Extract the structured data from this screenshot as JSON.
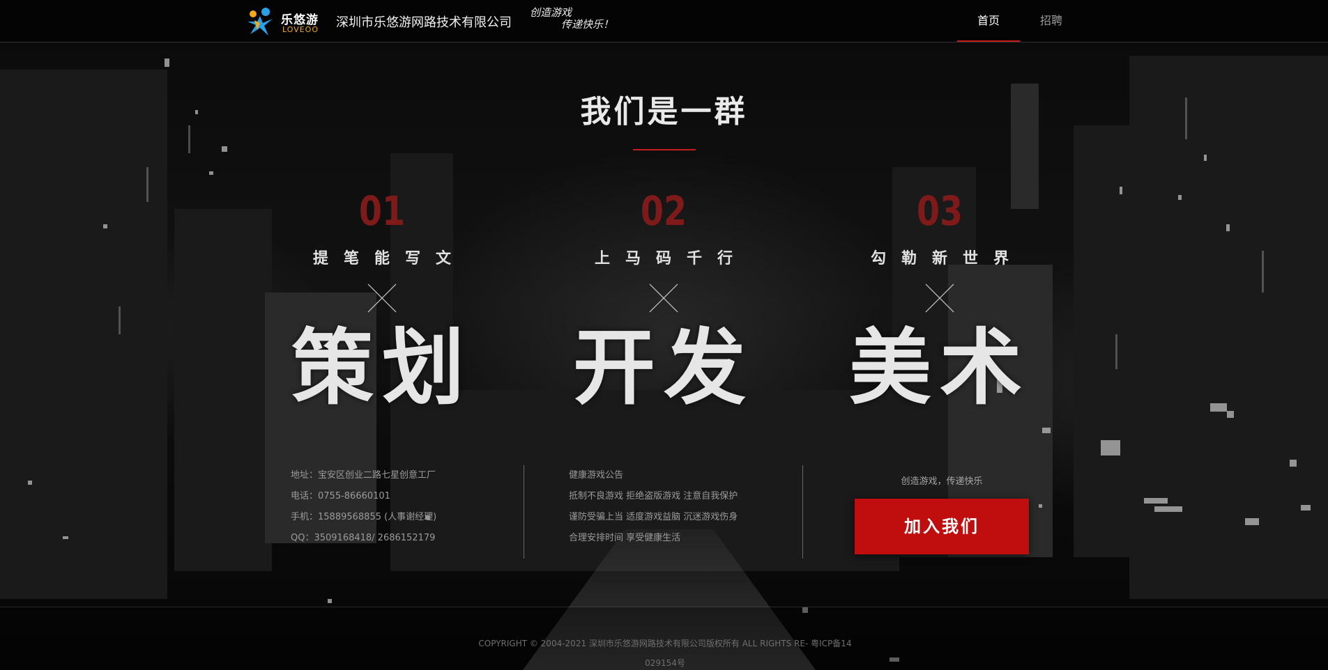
{
  "header": {
    "logo_cn": "乐悠游",
    "logo_en": "LOVEOO",
    "company_name": "深圳市乐悠游网路技术有限公司",
    "slogan_line1": "创造游戏",
    "slogan_line2": "传递快乐！",
    "nav": [
      {
        "label": "首页",
        "active": true
      },
      {
        "label": "招聘",
        "active": false
      }
    ]
  },
  "intro": {
    "title": "我们是一群"
  },
  "columns": [
    {
      "number": "01",
      "subtitle": "提笔能写文",
      "main": "策划"
    },
    {
      "number": "02",
      "subtitle": "上马码千行",
      "main": "开发"
    },
    {
      "number": "03",
      "subtitle": "勾勒新世界",
      "main": "美术"
    }
  ],
  "contact": {
    "address": "地址：宝安区创业二路七星创意工厂",
    "phone": "电话：0755-86660101",
    "mobile": "手机：15889568855 (人事谢经理)",
    "qq": "QQ：3509168418/ 2686152179"
  },
  "notice": {
    "title": "健康游戏公告",
    "line1": "抵制不良游戏 拒绝盗版游戏 注意自我保护",
    "line2": "谨防受骗上当 适度游戏益脑 沉迷游戏伤身",
    "line3": "合理安排时间 享受健康生活"
  },
  "join": {
    "tagline": "创造游戏，传递快乐",
    "button_label": "加入我们"
  },
  "footer": {
    "copyright": "COPYRIGHT © 2004-2021 深圳市乐悠游网路技术有限公司版权所有 ALL RIGHTS RE-",
    "icp": "粤ICP备14029154号"
  },
  "colors": {
    "accent_red": "#c81b1b",
    "button_red": "#c00d0d",
    "number_red": "#7f1a1a",
    "background": "#050505"
  }
}
